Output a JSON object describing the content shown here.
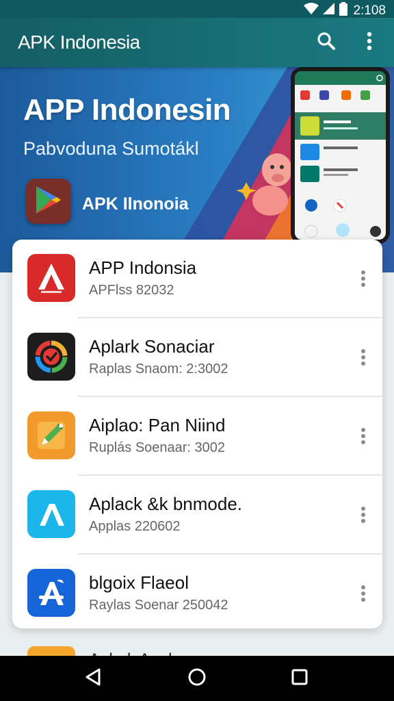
{
  "status_bar": {
    "time": "2:108"
  },
  "app_bar": {
    "title": "APK Indonesia"
  },
  "hero": {
    "title": "APP Indonesin",
    "subtitle": "Pabvoduna Sumotákl",
    "logo_label": "APK Ilnonoia"
  },
  "apps": [
    {
      "name": "APP Indonsia",
      "meta": "APFlss 82032",
      "icon": "brand-a-icon",
      "color": "#d92a2a"
    },
    {
      "name": "Aplark Sonaciar",
      "meta": "Raplas Snaom: 2:3002",
      "icon": "ring-check-icon",
      "color": "#1d1d1d"
    },
    {
      "name": "Aiplao: Pan Niind",
      "meta": "Ruplás Soenaar: 3002",
      "icon": "pencil-icon",
      "color": "#f29a2e"
    },
    {
      "name": "Aplack &k bnmode.",
      "meta": "Applas 220602",
      "icon": "lambda-icon",
      "color": "#1db6ea"
    },
    {
      "name": "blgoix Flaeol",
      "meta": "Raylas Soenar 250042",
      "icon": "app-store-icon",
      "color": "#1565d8"
    }
  ],
  "peek_item": {
    "name": "Aplark Anel"
  }
}
